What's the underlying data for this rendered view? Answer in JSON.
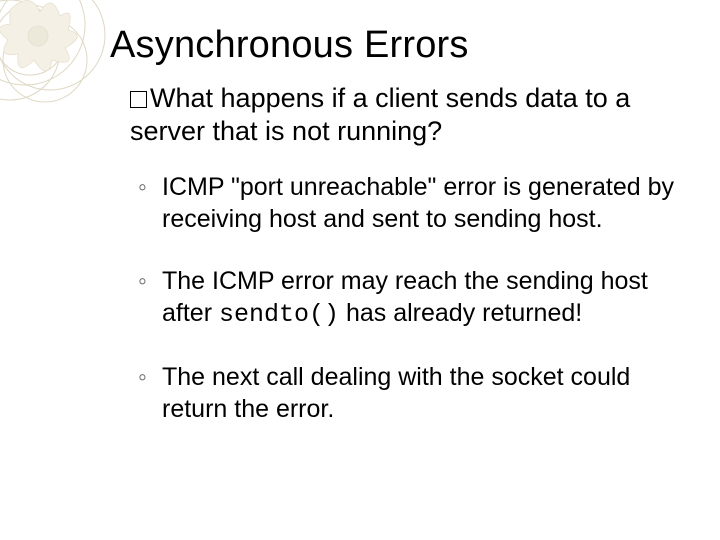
{
  "title": "Asynchronous Errors",
  "question_prefix": "What",
  "question_rest": " happens if a client sends data to a server that is not running?",
  "bullets": {
    "b1": "ICMP \"port unreachable\" error is generated by receiving host and sent to sending host.",
    "b2_pre": "The ICMP error may reach the sending host after ",
    "b2_code": "sendto()",
    "b2_post": " has already returned!",
    "b3": "The next call dealing with the socket could return the error."
  }
}
